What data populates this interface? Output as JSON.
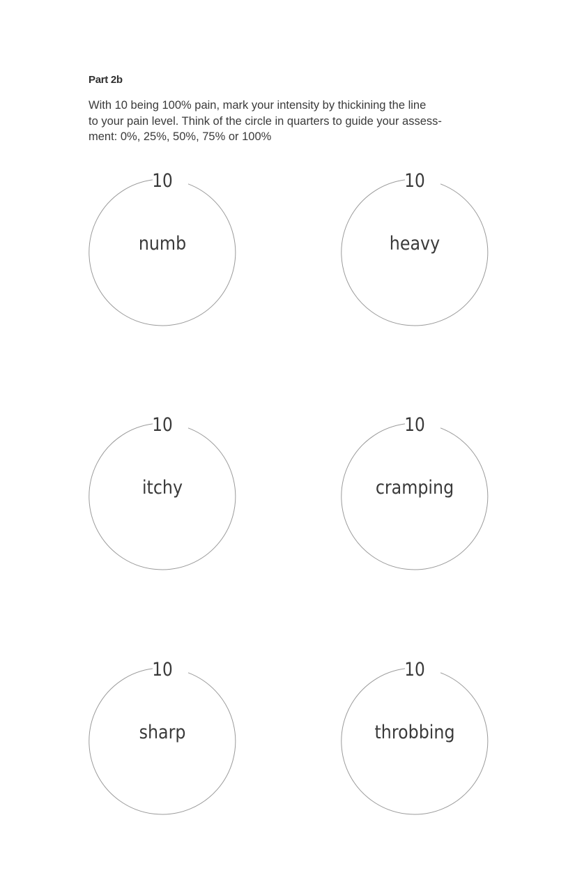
{
  "section": {
    "heading": "Part 2b",
    "instruction_lines": [
      "With 10 being 100% pain, mark your intensity by thickining the line",
      "to your pain level. Think of the circle in quarters to guide your assess-",
      "ment: 0%, 25%, 50%, 75% or 100%"
    ]
  },
  "dials": [
    {
      "max_label": "10",
      "descriptor": "numb"
    },
    {
      "max_label": "10",
      "descriptor": "heavy"
    },
    {
      "max_label": "10",
      "descriptor": "itchy"
    },
    {
      "max_label": "10",
      "descriptor": "cramping"
    },
    {
      "max_label": "10",
      "descriptor": "sharp"
    },
    {
      "max_label": "10",
      "descriptor": "throbbing"
    }
  ],
  "colors": {
    "circle_stroke": "#9a9a9a",
    "text": "#3a3a3a"
  }
}
